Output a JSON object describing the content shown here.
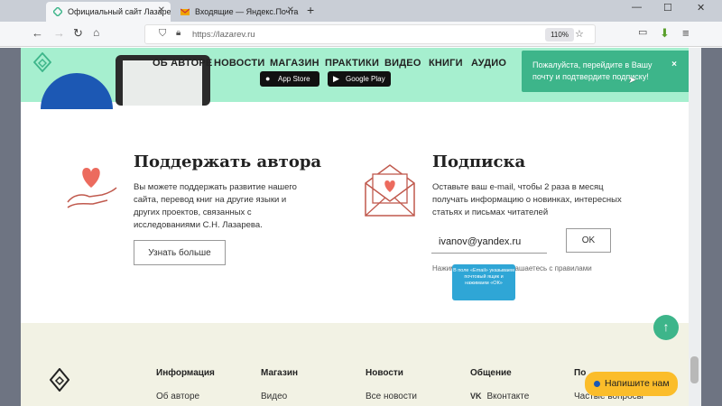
{
  "browser": {
    "tabs": [
      {
        "title": "Официальный сайт Лазарева"
      },
      {
        "title": "Входящие — Яндекс.Почта"
      }
    ],
    "new_tab": "+",
    "window_controls": [
      "—",
      "☐",
      "✕"
    ],
    "url": "https://lazarev.ru",
    "zoom": "110%"
  },
  "site": {
    "nav": [
      "ОБ АВТОРЕ",
      "НОВОСТИ",
      "МАГАЗИН",
      "ПРАКТИКИ",
      "ВИДЕО",
      "КНИГИ",
      "АУДИО"
    ],
    "stores": [
      "App Store",
      "Google Play"
    ],
    "toast": {
      "text": "Пожалуйста, перейдите в Вашу почту и подтвердите подписку!",
      "close": "×"
    },
    "support": {
      "title": "Поддержать автора",
      "text": "Вы можете поддержать развитие нашего сайта, перевод книг на другие языки и других проектов, связанных с исследованиями С.Н. Лазарева.",
      "button": "Узнать больше"
    },
    "subscribe": {
      "title": "Подписка",
      "text": "Оставьте ваш e-mail, чтобы 2 раза в месяц получать информацию о новинках, интересных статьях и письмах читателей",
      "email_value": "ivanov@yandex.ru",
      "ok": "OK",
      "agree_prefix": "Нажим",
      "agree_suffix": "соглашаетесь с правилами",
      "tooltip": "В поле «Email» указываем почтовый ящик и нажимаем «ОК»"
    },
    "up_icon": "↑",
    "footer": {
      "columns": [
        {
          "heading": "Информация",
          "link": "Об авторе"
        },
        {
          "heading": "Магазин",
          "link": "Видео"
        },
        {
          "heading": "Новости",
          "link": "Все новости"
        },
        {
          "heading": "Общение",
          "link": "Вконтакте"
        },
        {
          "heading": "По",
          "link": "Частые вопросы"
        }
      ],
      "chat": "Напишите нам"
    }
  },
  "colors": {
    "accent": "#3db58a",
    "hero": "#a6efcf",
    "chat": "#fbbd2a",
    "footer_bg": "#f2f2e4"
  }
}
